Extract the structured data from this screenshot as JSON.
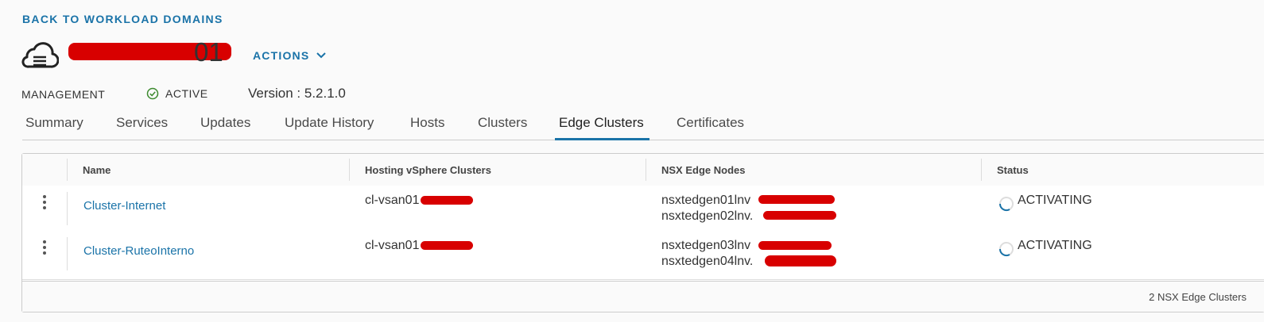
{
  "nav": {
    "back_label": "BACK TO WORKLOAD DOMAINS"
  },
  "domain": {
    "title": "01",
    "actions_label": "ACTIONS",
    "type_label": "MANAGEMENT",
    "status_label": "ACTIVE",
    "version_label": "Version : 5.2.1.0"
  },
  "tabs": [
    {
      "label": "Summary"
    },
    {
      "label": "Services"
    },
    {
      "label": "Updates"
    },
    {
      "label": "Update History"
    },
    {
      "label": "Hosts"
    },
    {
      "label": "Clusters"
    },
    {
      "label": "Edge Clusters"
    },
    {
      "label": "Certificates"
    }
  ],
  "active_tab": "Edge Clusters",
  "table": {
    "columns": [
      "Name",
      "Hosting vSphere Clusters",
      "NSX Edge Nodes",
      "Status"
    ],
    "rows": [
      {
        "name": "Cluster-Internet",
        "hosting": "cl-vsan01",
        "nodes": [
          "nsxtedgen01lnv",
          "nsxtedgen02lnv."
        ],
        "status": "ACTIVATING"
      },
      {
        "name": "Cluster-RuteoInterno",
        "hosting": "cl-vsan01",
        "nodes": [
          "nsxtedgen03lnv",
          "nsxtedgen04lnv."
        ],
        "status": "ACTIVATING"
      }
    ],
    "footer": "2 NSX Edge Clusters"
  },
  "colors": {
    "accent": "#1a73a8",
    "active_status": "#3c8a2e",
    "redaction": "#d80000"
  }
}
